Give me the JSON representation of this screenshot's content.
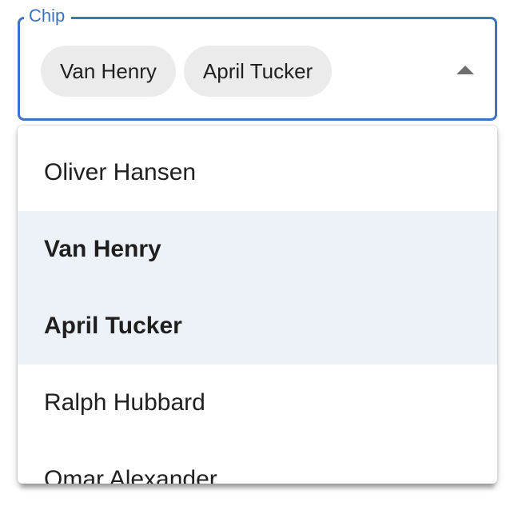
{
  "field": {
    "label": "Chip",
    "chips": [
      "Van Henry",
      "April Tucker"
    ],
    "arrow_icon": "arrow-drop-up-icon"
  },
  "menu": {
    "items": [
      {
        "label": "Oliver Hansen",
        "selected": false
      },
      {
        "label": "Van Henry",
        "selected": true
      },
      {
        "label": "April Tucker",
        "selected": true
      },
      {
        "label": "Ralph Hubbard",
        "selected": false
      },
      {
        "label": "Omar Alexander",
        "selected": false
      }
    ]
  },
  "colors": {
    "accent": "#3f73c0",
    "chip_bg": "#ebebeb",
    "selected_bg": "#edf2f9"
  }
}
